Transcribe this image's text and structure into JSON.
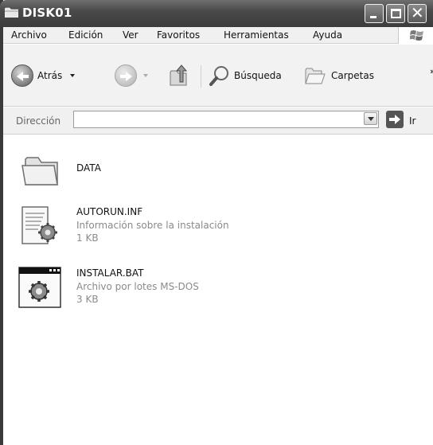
{
  "window": {
    "title": "DISK01"
  },
  "menu": {
    "items": [
      "Archivo",
      "Edición",
      "Ver",
      "Favoritos",
      "Herramientas",
      "Ayuda"
    ]
  },
  "toolbar": {
    "back_label": "Atrás",
    "search_label": "Búsqueda",
    "folders_label": "Carpetas",
    "overflow": "»"
  },
  "address": {
    "label": "Dirección",
    "value": "",
    "go_label": "Ir"
  },
  "files": [
    {
      "name": "DATA",
      "type": "",
      "size": "",
      "icon": "folder-icon"
    },
    {
      "name": "AUTORUN.INF",
      "type": "Información sobre la instalación",
      "size": "1 KB",
      "icon": "setup-info-file-icon"
    },
    {
      "name": "INSTALAR.BAT",
      "type": "Archivo por lotes MS-DOS",
      "size": "3 KB",
      "icon": "batch-file-icon"
    }
  ],
  "colors": {
    "titlebar": "#4a4a4a",
    "menubar": "#f0f0f0",
    "window_bg": "#ffffff",
    "secondary_text": "#8a8a8a"
  }
}
